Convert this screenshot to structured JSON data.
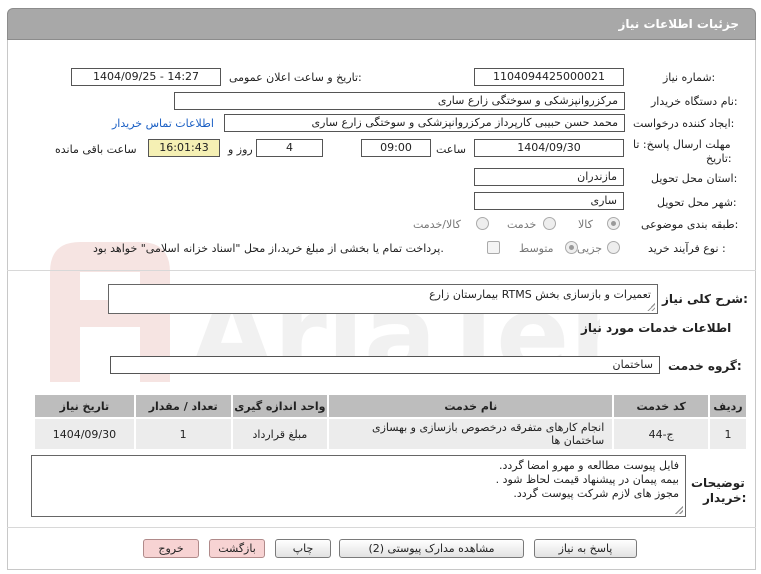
{
  "header": {
    "title": "جزئیات اطلاعات نیاز"
  },
  "form": {
    "need_number_label": "شماره نیاز:",
    "need_number": "1104094425000021",
    "announce_label": "تاریخ و ساعت اعلان عمومی:",
    "announce_value": "1404/09/25 - 14:27",
    "buyer_org_label": "نام دستگاه خریدار:",
    "buyer_org": "مرکزروانپزشکی و سوختگی زارع ساری",
    "requester_label": "ایجاد کننده درخواست:",
    "requester": "محمد حسن حبیبی کارپرداز مرکزروانپزشکی و سوختگی زارع ساری",
    "contact_link": "اطلاعات تماس خریدار",
    "deadline_label_1": "مهلت ارسال پاسخ: تا",
    "deadline_label_2": "تاریخ:",
    "deadline_date": "1404/09/30",
    "hour_label": "ساعت",
    "deadline_time": "09:00",
    "days_value": "4",
    "days_label": "روز و",
    "remaining_time": "16:01:43",
    "remaining_label": "ساعت باقی مانده",
    "province_label": "استان محل تحویل:",
    "province": "مازندران",
    "city_label": "شهر محل تحویل:",
    "city": "ساری",
    "category_label": "طبقه بندی موضوعی:",
    "category_options": [
      "کالا",
      "خدمت",
      "کالا/خدمت"
    ],
    "process_label": "نوع فرآیند خرید :",
    "process_options": [
      "جزیی",
      "متوسط"
    ],
    "payment_note": "پرداخت تمام یا بخشی از مبلغ خرید،از محل \"اسناد خزانه اسلامی\" خواهد بود."
  },
  "summary": {
    "label": "شرح کلی نیاز:",
    "value": "تعمیرات و بازسازی بخش RTMS بیمارستان زارع"
  },
  "services_title": "اطلاعات خدمات مورد نیاز",
  "service_group": {
    "label": "گروه خدمت:",
    "value": "ساختمان"
  },
  "table": {
    "headers": [
      "ردیف",
      "کد خدمت",
      "نام خدمت",
      "واحد اندازه گیری",
      "تعداد / مقدار",
      "تاریخ نیاز"
    ],
    "rows": [
      [
        "1",
        "ج-44",
        "انجام کارهای متفرقه درخصوص بازسازی و بهسازی ساختمان ها",
        "مبلغ قرارداد",
        "1",
        "1404/09/30"
      ]
    ]
  },
  "notes": {
    "label_1": "توضیحات",
    "label_2": "خریدار:",
    "lines": [
      "فایل پیوست مطالعه و مهرو امضا گردد.",
      "بیمه پیمان در پیشنهاد قیمت لحاظ شود .",
      "مجوز های لازم شرکت پیوست گردد."
    ]
  },
  "buttons": {
    "reply": "پاسخ به نیاز",
    "attachments": "مشاهده مدارک پیوستی (2)",
    "print": "چاپ",
    "back": "بازگشت",
    "exit": "خروج"
  },
  "watermark": "AriaTender.neT",
  "colors": {
    "header_bg": "#a8a8a8",
    "table_header": "#bdbdbd",
    "highlight": "#f5f0b4",
    "link": "#1a5fc4",
    "pink_button": "#f7d3d3"
  }
}
